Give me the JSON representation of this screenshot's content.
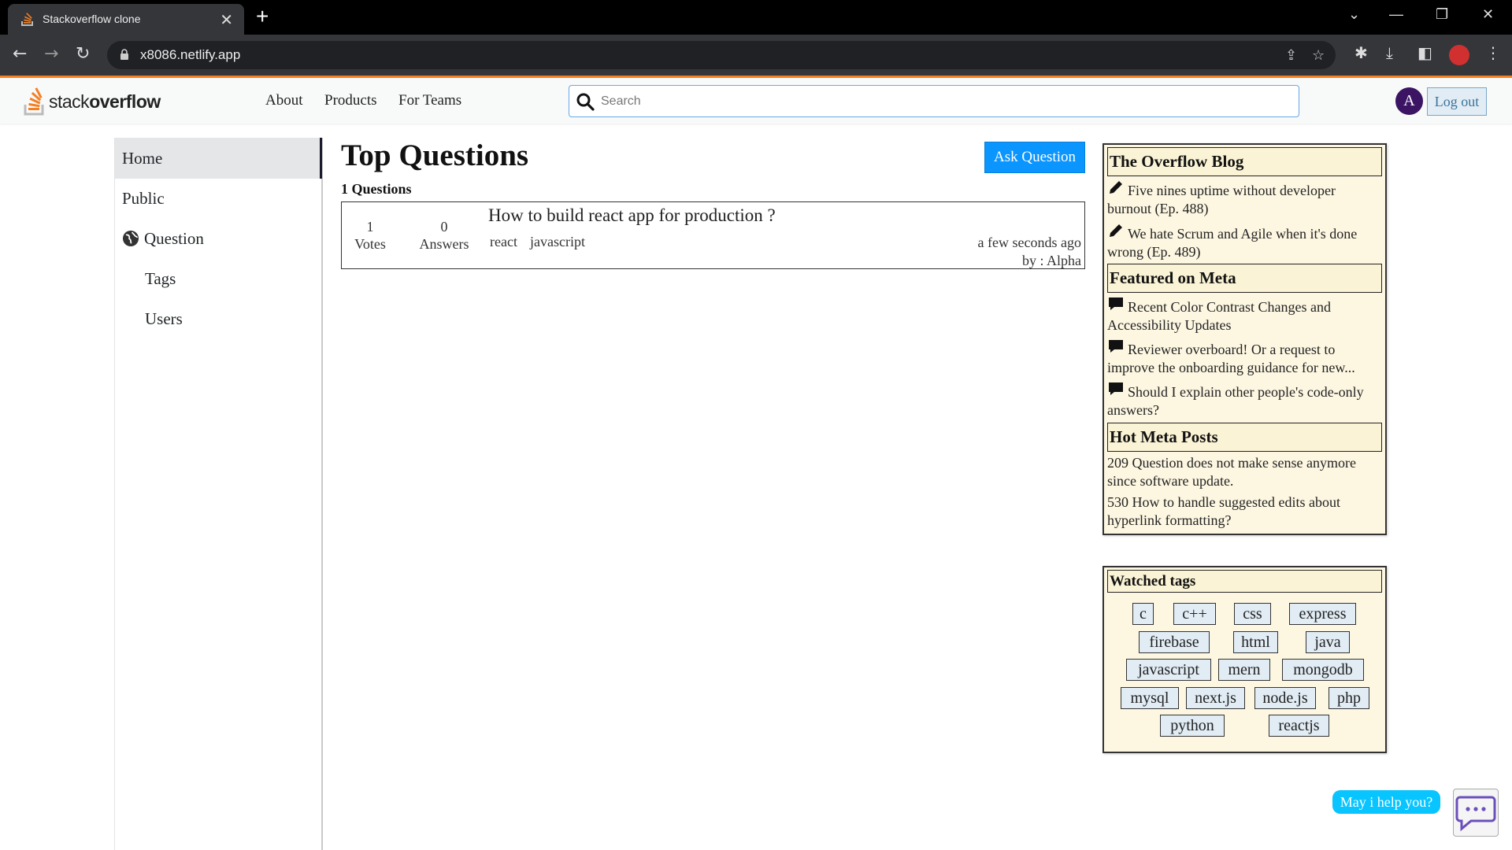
{
  "browser": {
    "tab_title": "Stackoverflow clone",
    "tab_close": "✕",
    "new_tab": "+",
    "url": "x8086.netlify.app",
    "window_controls": [
      "⌄",
      "—",
      "❐",
      "✕"
    ]
  },
  "header": {
    "logo_light": "stack",
    "logo_bold": "overflow",
    "nav": [
      "About",
      "Products",
      "For Teams"
    ],
    "search_placeholder": "Search",
    "avatar_letter": "A",
    "logout_label": "Log out",
    "accent_color": "#f48024"
  },
  "sidebar": {
    "items": [
      {
        "label": "Home",
        "active": true
      },
      {
        "label": "Public"
      },
      {
        "label": "Question",
        "icon": "globe-icon"
      },
      {
        "label": "Tags"
      },
      {
        "label": "Users"
      }
    ]
  },
  "main": {
    "title": "Top Questions",
    "ask_button": "Ask Question",
    "count": "1 Questions",
    "questions": [
      {
        "votes": "1",
        "votes_label": "Votes",
        "answers": "0",
        "answers_label": "Answers",
        "title": "How to build react app for production ?",
        "tags": [
          "react",
          "javascript"
        ],
        "time": "a few seconds ago",
        "author": "by : Alpha"
      }
    ]
  },
  "widgets": {
    "blog": {
      "title": "The Overflow Blog",
      "items": [
        "Five nines uptime without developer burnout (Ep. 488)",
        "We hate Scrum and Agile when it's done wrong (Ep. 489)"
      ]
    },
    "meta": {
      "title": "Featured on Meta",
      "items": [
        "Recent Color Contrast Changes and Accessibility Updates",
        "Reviewer overboard! Or a request to improve the onboarding guidance for new...",
        "Should I explain other people's code-only answers?"
      ]
    },
    "hot": {
      "title": "Hot Meta Posts",
      "items": [
        "209 Question does not make sense anymore since software update.",
        "530 How to handle suggested edits about hyperlink formatting?"
      ]
    },
    "watched": {
      "title": "Watched tags",
      "tags": [
        "c",
        "c++",
        "css",
        "express",
        "firebase",
        "html",
        "java",
        "javascript",
        "mern",
        "mongodb",
        "mysql",
        "next.js",
        "node.js",
        "php",
        "python",
        "reactjs"
      ]
    }
  },
  "chat": {
    "bubble": "May i help you?"
  }
}
